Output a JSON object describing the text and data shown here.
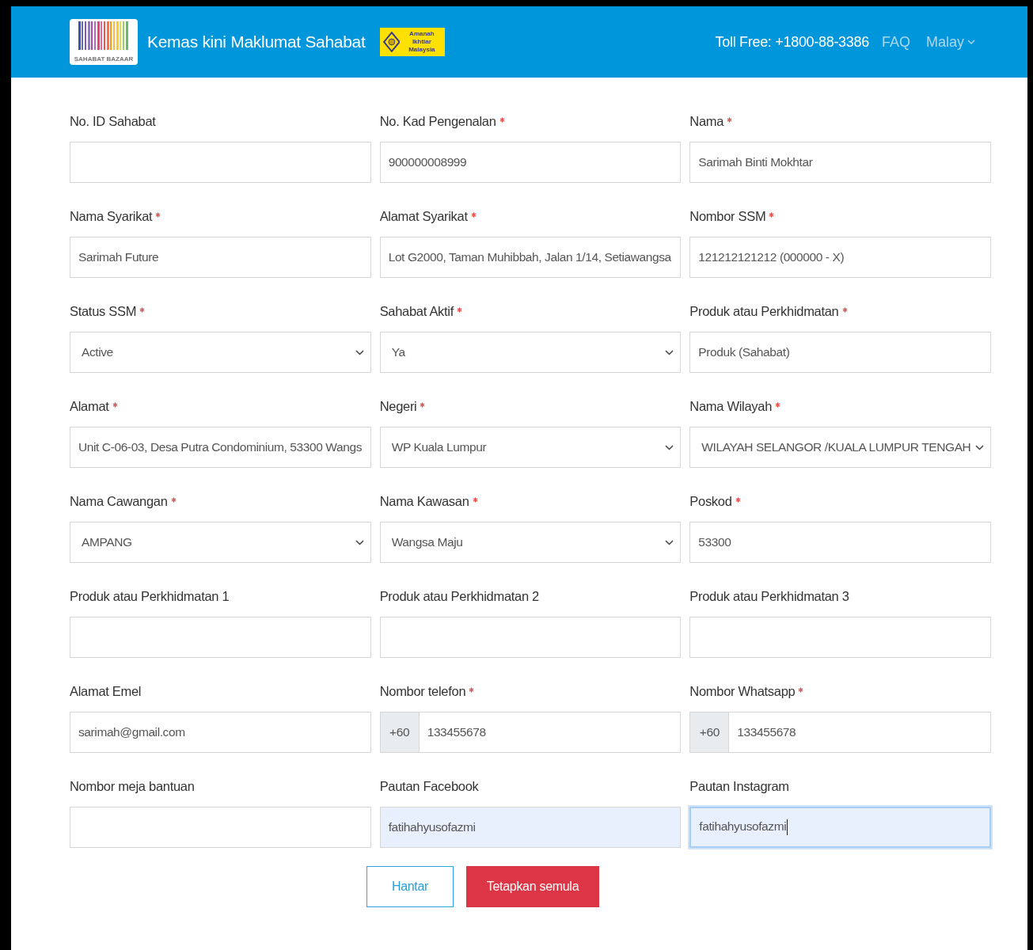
{
  "header": {
    "logo_text": "SAHABAT BAZAAR",
    "title": "Kemas kini Maklumat Sahabat",
    "badge_text": "Amanah Ikhtiar Malaysia",
    "toll_free": "Toll Free: +1800-88-3386",
    "faq": "FAQ",
    "language": "Malay"
  },
  "fields": [
    {
      "kind": "text",
      "label": "No. ID Sahabat",
      "required": false,
      "autofilled": false,
      "focused": false
    },
    {
      "kind": "text",
      "label": "No. Kad Pengenalan",
      "required": true,
      "value": "900000008999",
      "autofilled": false,
      "focused": false
    },
    {
      "kind": "text",
      "label": "Nama",
      "required": true,
      "value": "Sarimah Binti Mokhtar",
      "autofilled": false,
      "focused": false
    },
    {
      "kind": "text",
      "label": "Nama Syarikat",
      "required": true,
      "value": "Sarimah Future",
      "autofilled": false,
      "focused": false
    },
    {
      "kind": "text",
      "label": "Alamat Syarikat",
      "required": true,
      "value": "Lot G2000, Taman Muhibbah, Jalan 1/14, Setiawangsa",
      "autofilled": false,
      "focused": false
    },
    {
      "kind": "text",
      "label": "Nombor SSM",
      "required": true,
      "value": "121212121212 (000000 - X)",
      "autofilled": false,
      "focused": false
    },
    {
      "kind": "select",
      "label": "Status SSM",
      "required": true,
      "value": "Active",
      "autofilled": false,
      "focused": false
    },
    {
      "kind": "select",
      "label": "Sahabat Aktif",
      "required": true,
      "value": "Ya",
      "autofilled": false,
      "focused": false
    },
    {
      "kind": "text",
      "label": "Produk atau Perkhidmatan",
      "required": true,
      "value": "Produk (Sahabat)",
      "autofilled": false,
      "focused": false
    },
    {
      "kind": "text",
      "label": "Alamat",
      "required": true,
      "value": "Unit C-06-03, Desa Putra Condominium, 53300 Wangs",
      "autofilled": false,
      "focused": false
    },
    {
      "kind": "select",
      "label": "Negeri",
      "required": true,
      "value": "WP Kuala Lumpur",
      "autofilled": false,
      "focused": false
    },
    {
      "kind": "select",
      "label": "Nama Wilayah",
      "required": true,
      "value": "WILAYAH SELANGOR /KUALA LUMPUR TENGAH",
      "autofilled": false,
      "focused": false
    },
    {
      "kind": "select",
      "label": "Nama Cawangan",
      "required": true,
      "value": "AMPANG",
      "autofilled": false,
      "focused": false
    },
    {
      "kind": "select",
      "label": "Nama Kawasan",
      "required": true,
      "value": "Wangsa Maju",
      "autofilled": false,
      "focused": false
    },
    {
      "kind": "text",
      "label": "Poskod",
      "required": true,
      "value": "53300",
      "autofilled": false,
      "focused": false
    },
    {
      "kind": "text",
      "label": "Produk atau Perkhidmatan 1",
      "required": false,
      "autofilled": false,
      "focused": false
    },
    {
      "kind": "text",
      "label": "Produk atau Perkhidmatan 2",
      "required": false,
      "autofilled": false,
      "focused": false
    },
    {
      "kind": "text",
      "label": "Produk atau Perkhidmatan 3",
      "required": false,
      "autofilled": false,
      "focused": false
    },
    {
      "kind": "text",
      "label": "Alamat Emel",
      "required": false,
      "value": "sarimah@gmail.com",
      "autofilled": false,
      "focused": false
    },
    {
      "kind": "phone",
      "label": "Nombor telefon",
      "required": true,
      "prefix": "+60",
      "value": "133455678",
      "autofilled": false,
      "focused": false
    },
    {
      "kind": "phone",
      "label": "Nombor Whatsapp",
      "required": true,
      "prefix": "+60",
      "value": "133455678",
      "autofilled": false,
      "focused": false
    },
    {
      "kind": "text",
      "label": "Nombor meja bantuan",
      "required": false,
      "autofilled": false,
      "focused": false
    },
    {
      "kind": "text",
      "label": "Pautan Facebook",
      "required": false,
      "value": "fatihahyusofazmi",
      "autofilled": true,
      "focused": false
    },
    {
      "kind": "text",
      "label": "Pautan Instagram",
      "required": false,
      "value": "fatihahyusofazmi",
      "autofilled": true,
      "focused": true
    }
  ],
  "buttons": [
    {
      "kind": "outline",
      "label": "Hantar"
    },
    {
      "kind": "danger",
      "label": "Tetapkan semula"
    }
  ]
}
